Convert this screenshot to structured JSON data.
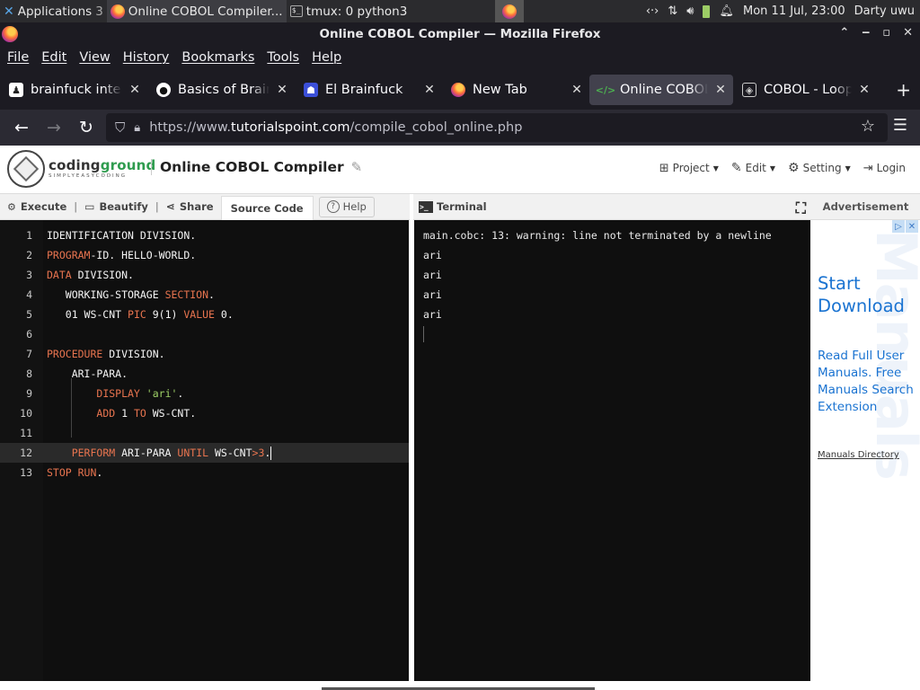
{
  "taskbar": {
    "items": [
      {
        "label": "Applications",
        "suffix": "3"
      },
      {
        "label": "Online COBOL Compiler..."
      },
      {
        "label": "tmux: 0 python3"
      }
    ],
    "clock": "Mon 11 Jul, 23:00",
    "user": "Darty uwu"
  },
  "window": {
    "title": "Online COBOL Compiler — Mozilla Firefox"
  },
  "menu": [
    "File",
    "Edit",
    "View",
    "History",
    "Bookmarks",
    "Tools",
    "Help"
  ],
  "tabs": [
    {
      "title": "brainfuck interpreter",
      "icon": "person-icon"
    },
    {
      "title": "Basics of BrainFuck",
      "icon": "github-icon"
    },
    {
      "title": "El Brainfuck",
      "icon": "robot-icon"
    },
    {
      "title": "New Tab",
      "icon": "firefox-icon"
    },
    {
      "title": "Online COBOL Compiler",
      "icon": "code-icon",
      "active": true
    },
    {
      "title": "COBOL - Loop Statements",
      "icon": "cobol-icon"
    }
  ],
  "url": {
    "prefix": "https://www.",
    "host": "tutorialspoint.com",
    "path": "/compile_cobol_online.php"
  },
  "site": {
    "logo_main_a": "coding",
    "logo_main_b": "ground",
    "logo_sub": "SIMPLYEASYCODING",
    "title": "Online COBOL Compiler",
    "nav": [
      "Project",
      "Edit",
      "Setting",
      "Login"
    ]
  },
  "toolbar": {
    "execute": "Execute",
    "beautify": "Beautify",
    "share": "Share",
    "source": "Source Code",
    "help": "Help"
  },
  "terminal": {
    "label": "Terminal",
    "lines": [
      "main.cobc: 13: warning: line not terminated by a newline",
      "ari",
      "ari",
      "ari",
      "ari"
    ]
  },
  "ad": {
    "header": "Advertisement",
    "headline": "Start Download",
    "body": "Read Full User Manuals. Free Manuals Search Extension",
    "link": "Manuals Directory",
    "bg_text": "Manuals"
  },
  "editor": {
    "current_line": 12,
    "lines": [
      [
        {
          "t": "IDENTIFICATION DIVISION."
        }
      ],
      [
        {
          "t": "PROGRAM",
          "c": "kw"
        },
        {
          "t": "-ID. HELLO-WORLD."
        }
      ],
      [
        {
          "t": "DATA",
          "c": "kw"
        },
        {
          "t": " DIVISION."
        }
      ],
      [
        {
          "t": "   WORKING-STORAGE "
        },
        {
          "t": "SECTION",
          "c": "kw"
        },
        {
          "t": "."
        }
      ],
      [
        {
          "t": "   01 WS-CNT "
        },
        {
          "t": "PIC",
          "c": "kw"
        },
        {
          "t": " 9(1) "
        },
        {
          "t": "VALUE",
          "c": "kw"
        },
        {
          "t": " 0."
        }
      ],
      [],
      [
        {
          "t": "PROCEDURE",
          "c": "kw"
        },
        {
          "t": " DIVISION."
        }
      ],
      [
        {
          "t": "    ARI-PARA."
        }
      ],
      [
        {
          "t": "        "
        },
        {
          "t": "DISPLAY",
          "c": "kw"
        },
        {
          "t": " "
        },
        {
          "t": "'ari'",
          "c": "str"
        },
        {
          "t": "."
        }
      ],
      [
        {
          "t": "        "
        },
        {
          "t": "ADD",
          "c": "kw"
        },
        {
          "t": " 1 "
        },
        {
          "t": "TO",
          "c": "kw"
        },
        {
          "t": " WS-CNT."
        }
      ],
      [],
      [
        {
          "t": "    "
        },
        {
          "t": "PERFORM",
          "c": "kw"
        },
        {
          "t": " ARI-PARA "
        },
        {
          "t": "UNTIL",
          "c": "kw"
        },
        {
          "t": " WS-CNT"
        },
        {
          "t": ">3",
          "c": "num"
        },
        {
          "t": "."
        }
      ],
      [
        {
          "t": "STOP RUN",
          "c": "kw"
        },
        {
          "t": "."
        }
      ]
    ]
  }
}
